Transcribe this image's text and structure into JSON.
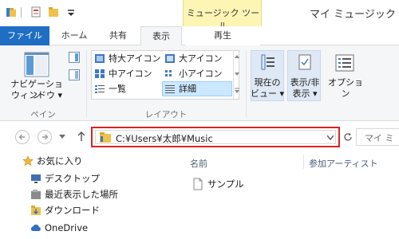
{
  "window": {
    "title": "マイ ミュージック"
  },
  "context_tab": {
    "group_title": "ミュージック ツール"
  },
  "tabs": [
    "ファイル",
    "ホーム",
    "共有",
    "表示",
    "再生"
  ],
  "ribbon": {
    "pane_group": {
      "nav_pane_label_1": "ナビゲーション",
      "nav_pane_label_2": "ウィンドウ ▾",
      "group_label": "ペイン"
    },
    "layout_group": {
      "items": [
        "特大アイコン",
        "大アイコン",
        "中アイコン",
        "小アイコン",
        "一覧",
        "詳細"
      ],
      "selected": "詳細",
      "group_label": "レイアウト"
    },
    "current_view": {
      "label_1": "現在の",
      "label_2": "ビュー ▾"
    },
    "show_hide": {
      "label_1": "表示/非",
      "label_2": "表示 ▾"
    },
    "options": {
      "label": "オプション"
    }
  },
  "address": {
    "path": "C:¥Users¥太郎¥Music",
    "search_placeholder": "マイ ミ"
  },
  "nav_pane": {
    "items": [
      {
        "label": "お気に入り",
        "icon": "star-icon"
      },
      {
        "label": "デスクトップ",
        "icon": "desktop-icon"
      },
      {
        "label": "最近表示した場所",
        "icon": "recent-places-icon"
      },
      {
        "label": "ダウンロード",
        "icon": "download-folder-icon"
      },
      {
        "label": "OneDrive",
        "icon": "cloud-icon"
      }
    ]
  },
  "file_list": {
    "columns": [
      "名前",
      "参加アーティスト"
    ],
    "rows": [
      {
        "name": "サンプル",
        "icon": "folder-icon"
      }
    ]
  },
  "colors": {
    "file_tab": "#1e6ec3",
    "context_band": "#fcf5b4",
    "highlight_border": "#e02222",
    "selection": "#cce8ff"
  }
}
